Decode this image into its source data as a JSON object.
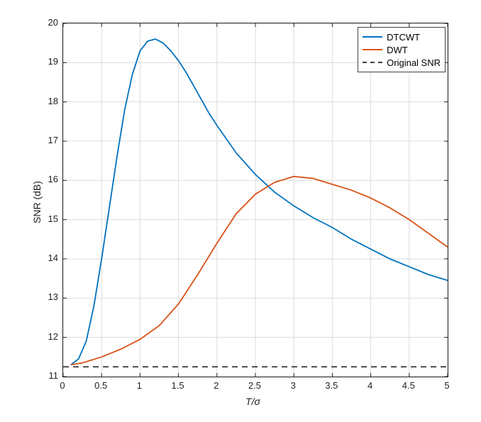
{
  "chart_data": {
    "type": "line",
    "xlabel": "T/σ",
    "ylabel": "SNR (dB)",
    "xlim": [
      0,
      5
    ],
    "ylim": [
      11,
      20
    ],
    "xticks": [
      0,
      0.5,
      1,
      1.5,
      2,
      2.5,
      3,
      3.5,
      4,
      4.5,
      5
    ],
    "yticks": [
      11,
      12,
      13,
      14,
      15,
      16,
      17,
      18,
      19,
      20
    ],
    "grid": true,
    "legend_position": "top-right",
    "series": [
      {
        "name": "DTCWT",
        "color": "#0072bd",
        "dash": "solid",
        "x": [
          0.1,
          0.2,
          0.3,
          0.4,
          0.5,
          0.6,
          0.7,
          0.8,
          0.9,
          1.0,
          1.1,
          1.2,
          1.3,
          1.4,
          1.5,
          1.6,
          1.7,
          1.8,
          1.9,
          2.0,
          2.25,
          2.5,
          2.75,
          3.0,
          3.25,
          3.5,
          3.75,
          4.0,
          4.25,
          4.5,
          4.75,
          5.0
        ],
        "y": [
          11.3,
          11.45,
          11.9,
          12.8,
          14.0,
          15.3,
          16.6,
          17.8,
          18.7,
          19.3,
          19.55,
          19.6,
          19.5,
          19.3,
          19.05,
          18.75,
          18.4,
          18.05,
          17.7,
          17.4,
          16.7,
          16.15,
          15.7,
          15.35,
          15.05,
          14.8,
          14.5,
          14.25,
          14.0,
          13.8,
          13.6,
          13.45
        ]
      },
      {
        "name": "DWT",
        "color": "#d95319",
        "dash": "solid",
        "x": [
          0.1,
          0.25,
          0.5,
          0.75,
          1.0,
          1.25,
          1.5,
          1.75,
          2.0,
          2.25,
          2.5,
          2.75,
          3.0,
          3.25,
          3.5,
          3.75,
          4.0,
          4.25,
          4.5,
          4.75,
          5.0
        ],
        "y": [
          11.3,
          11.35,
          11.5,
          11.7,
          11.95,
          12.3,
          12.85,
          13.6,
          14.4,
          15.15,
          15.65,
          15.95,
          16.1,
          16.05,
          15.9,
          15.75,
          15.55,
          15.3,
          15.0,
          14.65,
          14.3
        ]
      },
      {
        "name": "Original SNR",
        "color": "#404040",
        "dash": "dashed",
        "x": [
          0,
          5
        ],
        "y": [
          11.25,
          11.25
        ]
      }
    ]
  }
}
